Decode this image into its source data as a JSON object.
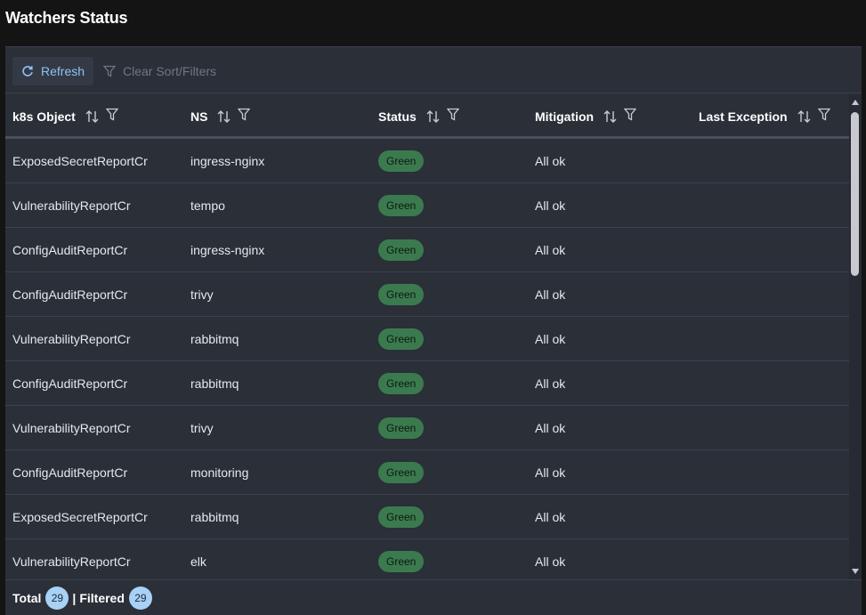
{
  "page": {
    "title": "Watchers Status"
  },
  "toolbar": {
    "refresh_label": "Refresh",
    "clear_label": "Clear Sort/Filters"
  },
  "columns": [
    {
      "label": "k8s Object"
    },
    {
      "label": "NS"
    },
    {
      "label": "Status"
    },
    {
      "label": "Mitigation"
    },
    {
      "label": "Last Exception"
    }
  ],
  "rows": [
    {
      "object": "ExposedSecretReportCr",
      "ns": "ingress-nginx",
      "status": "Green",
      "mitigation": "All ok",
      "exception": ""
    },
    {
      "object": "VulnerabilityReportCr",
      "ns": "tempo",
      "status": "Green",
      "mitigation": "All ok",
      "exception": ""
    },
    {
      "object": "ConfigAuditReportCr",
      "ns": "ingress-nginx",
      "status": "Green",
      "mitigation": "All ok",
      "exception": ""
    },
    {
      "object": "ConfigAuditReportCr",
      "ns": "trivy",
      "status": "Green",
      "mitigation": "All ok",
      "exception": ""
    },
    {
      "object": "VulnerabilityReportCr",
      "ns": "rabbitmq",
      "status": "Green",
      "mitigation": "All ok",
      "exception": ""
    },
    {
      "object": "ConfigAuditReportCr",
      "ns": "rabbitmq",
      "status": "Green",
      "mitigation": "All ok",
      "exception": ""
    },
    {
      "object": "VulnerabilityReportCr",
      "ns": "trivy",
      "status": "Green",
      "mitigation": "All ok",
      "exception": ""
    },
    {
      "object": "ConfigAuditReportCr",
      "ns": "monitoring",
      "status": "Green",
      "mitigation": "All ok",
      "exception": ""
    },
    {
      "object": "ExposedSecretReportCr",
      "ns": "rabbitmq",
      "status": "Green",
      "mitigation": "All ok",
      "exception": ""
    },
    {
      "object": "VulnerabilityReportCr",
      "ns": "elk",
      "status": "Green",
      "mitigation": "All ok",
      "exception": ""
    }
  ],
  "footer": {
    "total_label": "Total",
    "total": "29",
    "separator": "|",
    "filtered_label": "Filtered",
    "filtered": "29"
  },
  "icons": {
    "refresh": "refresh-icon",
    "filter": "filter-icon",
    "sort": "sort-icon"
  },
  "colors": {
    "accent": "#8fc1f2",
    "status_green": "#3b7a4e",
    "count_badge": "#a8d1f5",
    "panel_bg": "#2a2f38"
  }
}
